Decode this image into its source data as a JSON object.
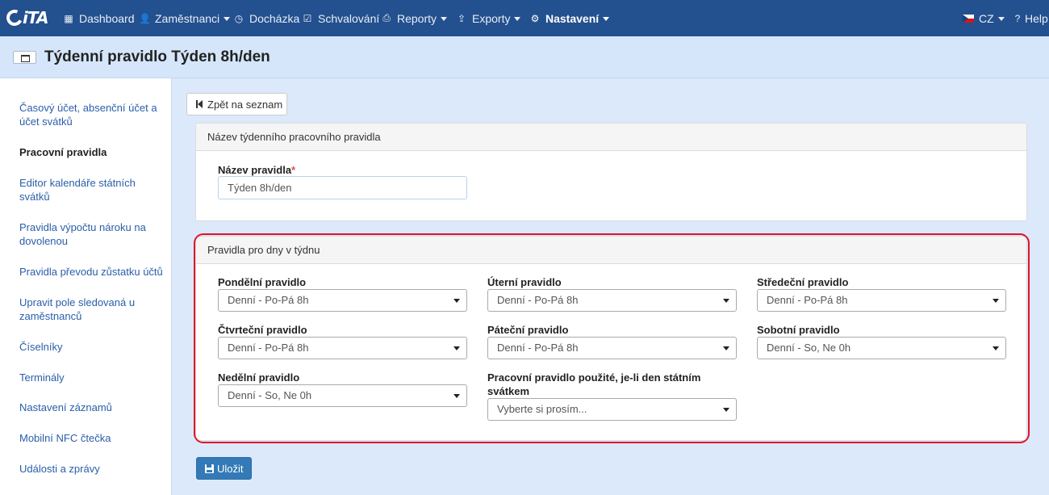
{
  "brand": {
    "logo_text": "iTA"
  },
  "nav": {
    "items": [
      {
        "label": "Dashboard",
        "icon": "grid-icon"
      },
      {
        "label": "Zaměstnanci",
        "icon": "user-icon"
      },
      {
        "label": "Docházka",
        "icon": "clock-icon"
      },
      {
        "label": "Schvalování",
        "icon": "check-circle-icon"
      },
      {
        "label": "Reporty",
        "icon": "printer-icon"
      },
      {
        "label": "Exporty",
        "icon": "export-icon"
      },
      {
        "label": "Nastavení",
        "icon": "gear-icon"
      }
    ],
    "language": "CZ",
    "help": "Help"
  },
  "page": {
    "title": "Týdenní pravidlo Týden 8h/den"
  },
  "sidebar": {
    "items": [
      {
        "label": "Časový účet, absenční účet a účet svátků"
      },
      {
        "label": "Pracovní pravidla"
      },
      {
        "label": "Editor kalendáře státních svátků"
      },
      {
        "label": "Pravidla výpočtu nároku na dovolenou"
      },
      {
        "label": "Pravidla převodu zůstatku účtů"
      },
      {
        "label": "Upravit pole sledovaná u zaměstnanců"
      },
      {
        "label": "Číselníky"
      },
      {
        "label": "Terminály"
      },
      {
        "label": "Nastavení záznamů"
      },
      {
        "label": "Mobilní NFC čtečka"
      },
      {
        "label": "Události a zprávy"
      }
    ]
  },
  "main": {
    "back_button": "Zpět na seznam",
    "name_panel": {
      "heading": "Název týdenního pracovního pravidla",
      "name_label": "Název pravidla",
      "required_mark": "*",
      "name_value": "Týden 8h/den"
    },
    "rules_panel": {
      "heading": "Pravidla pro dny v týdnu",
      "fields": [
        {
          "label": "Pondělní pravidlo",
          "value": "Denní - Po-Pá 8h"
        },
        {
          "label": "Úterní pravidlo",
          "value": "Denní - Po-Pá 8h"
        },
        {
          "label": "Středeční pravidlo",
          "value": "Denní - Po-Pá 8h"
        },
        {
          "label": "Čtvrteční pravidlo",
          "value": "Denní - Po-Pá 8h"
        },
        {
          "label": "Páteční pravidlo",
          "value": "Denní - Po-Pá 8h"
        },
        {
          "label": "Sobotní pravidlo",
          "value": "Denní - So, Ne 0h"
        },
        {
          "label": "Nedělní pravidlo",
          "value": "Denní - So, Ne 0h"
        },
        {
          "label": "Pracovní pravidlo použité, je-li den státním svátkem",
          "value": "Vyberte si prosím..."
        }
      ]
    },
    "save_button": "Uložit"
  },
  "colors": {
    "navbar": "#23508e",
    "accent": "#337ab7",
    "highlight": "#e2132a",
    "link": "#2a5ea8"
  }
}
